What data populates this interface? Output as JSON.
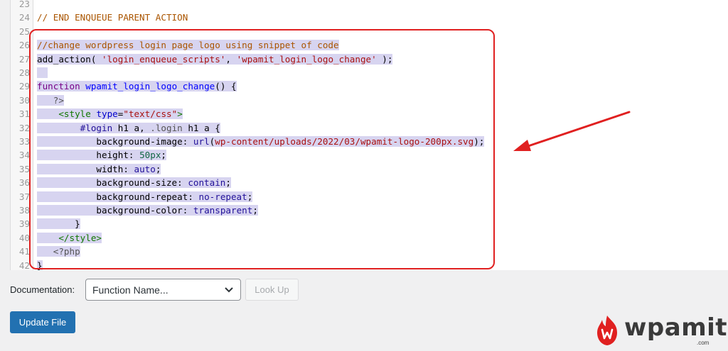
{
  "editor": {
    "lines": [
      {
        "n": "23",
        "selected": false,
        "tokens": [
          {
            "t": "",
            "c": ""
          }
        ]
      },
      {
        "n": "24",
        "selected": false,
        "tokens": [
          {
            "t": "// END ENQUEUE PARENT ACTION",
            "c": "c-comment"
          }
        ]
      },
      {
        "n": "25",
        "selected": false,
        "tokens": [
          {
            "t": "",
            "c": ""
          }
        ]
      },
      {
        "n": "26",
        "selected": true,
        "tokens": [
          {
            "t": "//change wordpress login page logo using snippet of code",
            "c": "c-comment"
          }
        ]
      },
      {
        "n": "27",
        "selected": true,
        "tokens": [
          {
            "t": "add_action( ",
            "c": ""
          },
          {
            "t": "'login_enqueue_scripts'",
            "c": "c-string"
          },
          {
            "t": ", ",
            "c": ""
          },
          {
            "t": "'wpamit_login_logo_change'",
            "c": "c-string"
          },
          {
            "t": " );",
            "c": ""
          }
        ]
      },
      {
        "n": "28",
        "selected": true,
        "tokens": [
          {
            "t": "  ",
            "c": ""
          }
        ]
      },
      {
        "n": "29",
        "selected": true,
        "tokens": [
          {
            "t": "function",
            "c": "c-keyword"
          },
          {
            "t": " ",
            "c": ""
          },
          {
            "t": "wpamit_login_logo_change",
            "c": "c-def"
          },
          {
            "t": "() {",
            "c": ""
          }
        ]
      },
      {
        "n": "30",
        "selected": true,
        "tokens": [
          {
            "t": "   ",
            "c": ""
          },
          {
            "t": "?>",
            "c": "c-meta"
          }
        ]
      },
      {
        "n": "31",
        "selected": true,
        "tokens": [
          {
            "t": "    ",
            "c": ""
          },
          {
            "t": "<style",
            "c": "c-tag"
          },
          {
            "t": " ",
            "c": ""
          },
          {
            "t": "type",
            "c": "c-attr"
          },
          {
            "t": "=",
            "c": ""
          },
          {
            "t": "\"text/css\"",
            "c": "c-string"
          },
          {
            "t": ">",
            "c": "c-tag"
          }
        ]
      },
      {
        "n": "32",
        "selected": true,
        "tokens": [
          {
            "t": "        ",
            "c": ""
          },
          {
            "t": "#login",
            "c": "c-atom"
          },
          {
            "t": " h1 a, ",
            "c": ""
          },
          {
            "t": ".login",
            "c": "c-qual"
          },
          {
            "t": " h1 a {",
            "c": ""
          }
        ]
      },
      {
        "n": "33",
        "selected": true,
        "tokens": [
          {
            "t": "           ",
            "c": ""
          },
          {
            "t": "background-image",
            "c": "c-prop"
          },
          {
            "t": ": ",
            "c": ""
          },
          {
            "t": "url",
            "c": "c-atom"
          },
          {
            "t": "(",
            "c": ""
          },
          {
            "t": "wp-content/uploads/2022/03/wpamit-logo-200px.svg",
            "c": "c-string"
          },
          {
            "t": ");",
            "c": ""
          }
        ]
      },
      {
        "n": "34",
        "selected": true,
        "tokens": [
          {
            "t": "           ",
            "c": ""
          },
          {
            "t": "height",
            "c": "c-prop"
          },
          {
            "t": ": ",
            "c": ""
          },
          {
            "t": "50px",
            "c": "c-num"
          },
          {
            "t": ";",
            "c": ""
          }
        ]
      },
      {
        "n": "35",
        "selected": true,
        "tokens": [
          {
            "t": "           ",
            "c": ""
          },
          {
            "t": "width",
            "c": "c-prop"
          },
          {
            "t": ": ",
            "c": ""
          },
          {
            "t": "auto",
            "c": "c-atom"
          },
          {
            "t": ";",
            "c": ""
          }
        ]
      },
      {
        "n": "36",
        "selected": true,
        "tokens": [
          {
            "t": "           ",
            "c": ""
          },
          {
            "t": "background-size",
            "c": "c-prop"
          },
          {
            "t": ": ",
            "c": ""
          },
          {
            "t": "contain",
            "c": "c-atom"
          },
          {
            "t": ";",
            "c": ""
          }
        ]
      },
      {
        "n": "37",
        "selected": true,
        "tokens": [
          {
            "t": "           ",
            "c": ""
          },
          {
            "t": "background-repeat",
            "c": "c-prop"
          },
          {
            "t": ": ",
            "c": ""
          },
          {
            "t": "no-repeat",
            "c": "c-atom"
          },
          {
            "t": ";",
            "c": ""
          }
        ]
      },
      {
        "n": "38",
        "selected": true,
        "tokens": [
          {
            "t": "           ",
            "c": ""
          },
          {
            "t": "background-color",
            "c": "c-prop"
          },
          {
            "t": ": ",
            "c": ""
          },
          {
            "t": "transparent",
            "c": "c-atom"
          },
          {
            "t": ";",
            "c": ""
          }
        ]
      },
      {
        "n": "39",
        "selected": true,
        "tokens": [
          {
            "t": "       }",
            "c": ""
          }
        ]
      },
      {
        "n": "40",
        "selected": true,
        "tokens": [
          {
            "t": "    ",
            "c": ""
          },
          {
            "t": "</style>",
            "c": "c-tag"
          }
        ]
      },
      {
        "n": "41",
        "selected": true,
        "tokens": [
          {
            "t": "   ",
            "c": ""
          },
          {
            "t": "<?php",
            "c": "c-meta"
          }
        ]
      },
      {
        "n": "42",
        "selected": true,
        "tokens": [
          {
            "t": "}",
            "c": ""
          }
        ]
      }
    ]
  },
  "documentation": {
    "label": "Documentation:",
    "select_value": "Function Name...",
    "lookup_label": "Look Up"
  },
  "update_button": "Update File",
  "logo": {
    "text": "wpamit",
    "sub": ".com",
    "color": "#e02020"
  },
  "colors": {
    "accent": "#2271b1",
    "highlight": "#e02020",
    "selection": "#d7d4f0"
  }
}
